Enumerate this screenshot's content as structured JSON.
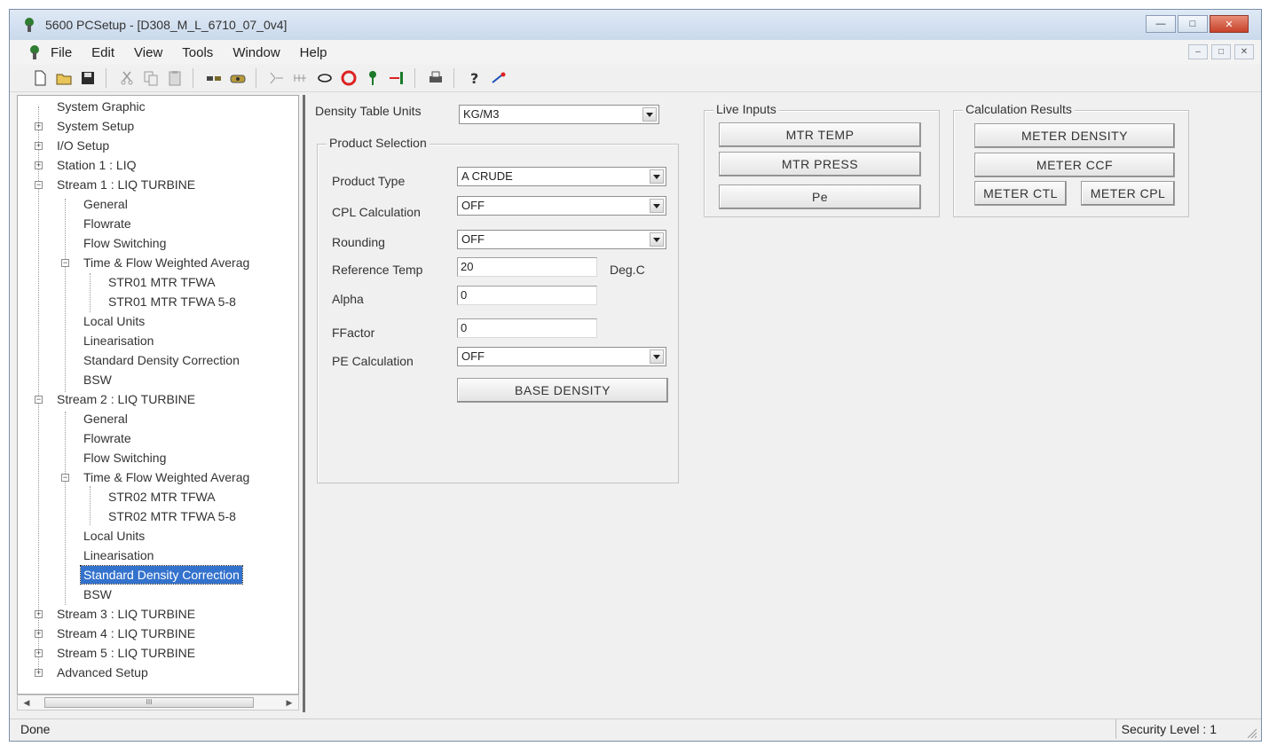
{
  "window": {
    "title": "5600 PCSetup - [D308_M_L_6710_07_0v4]"
  },
  "menu": [
    "File",
    "Edit",
    "View",
    "Tools",
    "Window",
    "Help"
  ],
  "toolbar_icons": [
    "new-icon",
    "open-icon",
    "save-icon",
    "cut-icon",
    "copy-icon",
    "paste-icon",
    "connect-icon",
    "disconnect-icon",
    "link-icon",
    "port-icon",
    "loop-icon",
    "stop-icon",
    "pin-icon",
    "exit-icon",
    "print-icon",
    "help-icon",
    "whatsthis-icon"
  ],
  "tree": {
    "items": [
      "System Graphic",
      "System Setup",
      "I/O Setup",
      "Station 1 : LIQ",
      "Stream 1 : LIQ TURBINE",
      "General",
      "Flowrate",
      "Flow Switching",
      "Time & Flow Weighted Averag",
      "STR01 MTR TFWA",
      "STR01 MTR TFWA 5-8",
      "Local Units",
      "Linearisation",
      "Standard Density Correction",
      "BSW",
      "Stream 2 : LIQ TURBINE",
      "General",
      "Flowrate",
      "Flow Switching",
      "Time & Flow Weighted Averag",
      "STR02 MTR TFWA",
      "STR02 MTR TFWA 5-8",
      "Local Units",
      "Linearisation",
      "Standard Density Correction",
      "BSW",
      "Stream 3 : LIQ TURBINE",
      "Stream 4 : LIQ TURBINE",
      "Stream 5 : LIQ TURBINE",
      "Advanced Setup"
    ],
    "selected_index": 24
  },
  "scrollbar": {
    "thumb_label": "III"
  },
  "form": {
    "density_table_units_label": "Density Table Units",
    "density_table_units_value": "KG/M3",
    "product_selection_title": "Product Selection",
    "product_type_label": "Product Type",
    "product_type_value": "A CRUDE",
    "cpl_calc_label": "CPL Calculation",
    "cpl_calc_value": "OFF",
    "rounding_label": "Rounding",
    "rounding_value": "OFF",
    "reference_temp_label": "Reference Temp",
    "reference_temp_value": "20",
    "reference_temp_unit": "Deg.C",
    "alpha_label": "Alpha",
    "alpha_value": "0",
    "ffactor_label": "FFactor",
    "ffactor_value": "0",
    "pe_calc_label": "PE Calculation",
    "pe_calc_value": "OFF",
    "base_density_button": "BASE DENSITY"
  },
  "live_inputs": {
    "title": "Live Inputs",
    "buttons": [
      "MTR TEMP",
      "MTR PRESS",
      "Pe"
    ]
  },
  "calc_results": {
    "title": "Calculation Results",
    "buttons": [
      "METER DENSITY",
      "METER CCF",
      "METER CTL",
      "METER CPL"
    ]
  },
  "status": {
    "left": "Done",
    "right": "Security Level : 1"
  }
}
